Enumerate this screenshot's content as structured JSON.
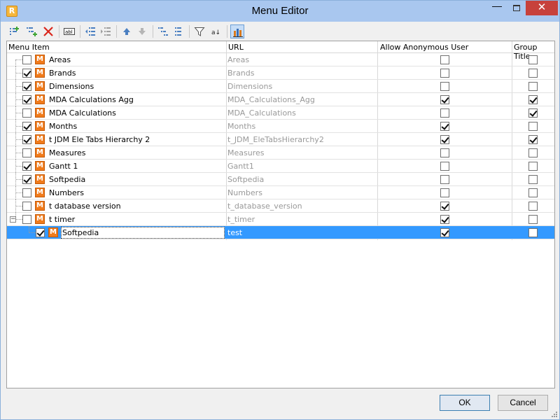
{
  "window": {
    "title": "Menu Editor",
    "app_icon_letter": "R",
    "minimize_glyph": "—",
    "close_glyph": "✕"
  },
  "toolbar": {
    "buttons": [
      {
        "icon": "add-item-icon"
      },
      {
        "icon": "add-child-item-icon"
      },
      {
        "icon": "delete-icon"
      },
      {
        "icon": "rename-icon",
        "text": "abl"
      },
      {
        "icon": "outdent-icon"
      },
      {
        "icon": "indent-icon"
      },
      {
        "icon": "move-up-icon"
      },
      {
        "icon": "move-down-icon"
      },
      {
        "icon": "expand-all-icon"
      },
      {
        "icon": "collapse-all-icon"
      },
      {
        "icon": "filter-icon"
      },
      {
        "icon": "sort-alpha-icon",
        "text": "a↓"
      },
      {
        "icon": "chart-icon",
        "active": true
      }
    ]
  },
  "grid": {
    "columns": {
      "menu_item": "Menu Item",
      "url": "URL",
      "allow_anonymous": "Allow Anonymous User",
      "group_title": "Group Title"
    },
    "rows": [
      {
        "label": "Areas",
        "url": "Areas",
        "checked": false,
        "anon": false,
        "group": false
      },
      {
        "label": "Brands",
        "url": "Brands",
        "checked": true,
        "anon": false,
        "group": false
      },
      {
        "label": "Dimensions",
        "url": "Dimensions",
        "checked": true,
        "anon": false,
        "group": false
      },
      {
        "label": "MDA Calculations Agg",
        "url": "MDA_Calculations_Agg",
        "checked": true,
        "anon": true,
        "group": true
      },
      {
        "label": "MDA Calculations",
        "url": "MDA_Calculations",
        "checked": false,
        "anon": false,
        "group": true
      },
      {
        "label": "Months",
        "url": "Months",
        "checked": true,
        "anon": true,
        "group": false
      },
      {
        "label": "t JDM Ele Tabs Hierarchy 2",
        "url": "t_JDM_EleTabsHierarchy2",
        "checked": true,
        "anon": true,
        "group": true
      },
      {
        "label": "Measures",
        "url": "Measures",
        "checked": false,
        "anon": false,
        "group": false
      },
      {
        "label": "Gantt 1",
        "url": "Gantt1",
        "checked": true,
        "anon": false,
        "group": false
      },
      {
        "label": "Softpedia",
        "url": "Softpedia",
        "checked": true,
        "anon": false,
        "group": false
      },
      {
        "label": "Numbers",
        "url": "Numbers",
        "checked": false,
        "anon": false,
        "group": false
      },
      {
        "label": "t database version",
        "url": "t_database_version",
        "checked": false,
        "anon": true,
        "group": false
      },
      {
        "label": "t timer",
        "url": "t_timer",
        "checked": false,
        "anon": true,
        "group": false,
        "expanded": true
      },
      {
        "label": "Softpedia",
        "url": "test",
        "checked": true,
        "anon": true,
        "group": false,
        "child": true,
        "selected": true
      }
    ]
  },
  "footer": {
    "ok_label": "OK",
    "cancel_label": "Cancel"
  },
  "item_icon_letter": "M",
  "colors": {
    "titlebar": "#a9c7ef",
    "close_button": "#c7413c",
    "selection": "#3399ff",
    "item_icon": "#f07b1c"
  }
}
